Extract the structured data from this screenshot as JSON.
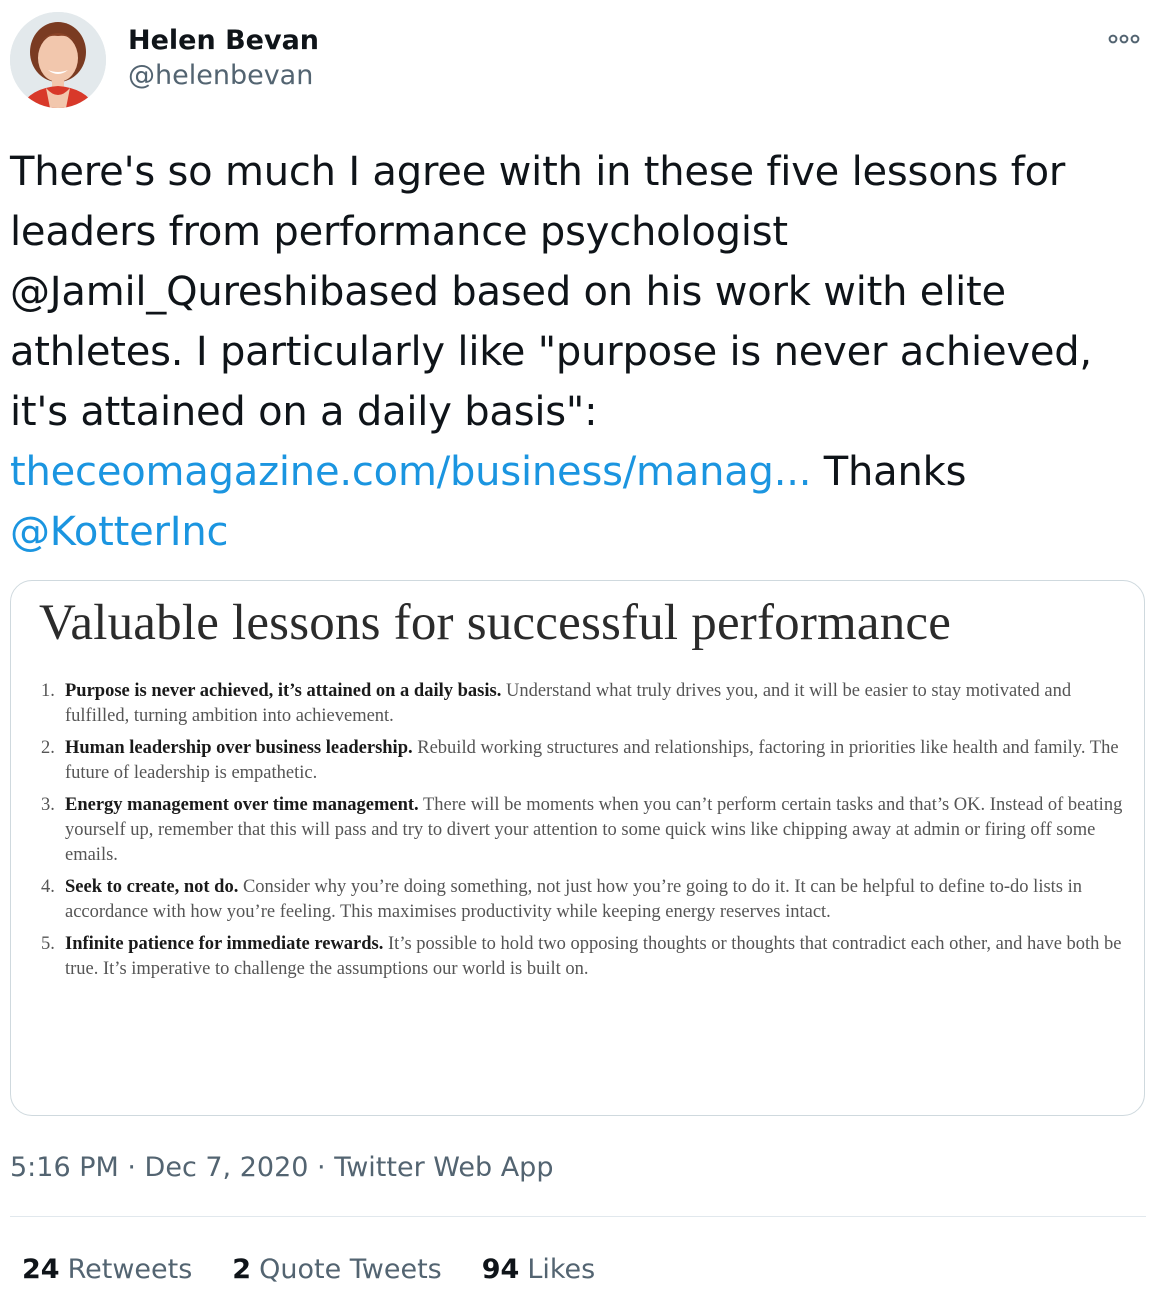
{
  "author": {
    "display_name": "Helen Bevan",
    "handle": "@helenbevan",
    "avatar_icon": "profile-photo"
  },
  "menu": {
    "more_icon": "more-options-icon"
  },
  "tweet": {
    "text_part1": "There's so much I agree with in these five lessons for leaders from performance psychologist @Jamil_Qureshibased based on his work with elite athletes. I particularly like \"purpose is never achieved, it's attained on a daily basis\": ",
    "link_text": "theceomagazine.com/business/manag...",
    "text_part2": " Thanks ",
    "mention": "@KotterInc"
  },
  "media": {
    "title": "Valuable lessons for successful performance",
    "lessons": [
      {
        "number": "1.",
        "heading": "Purpose is never achieved, it’s attained on a daily basis.",
        "body": " Understand what truly drives you, and it will be easier to stay motivated and fulfilled, turning ambition into achievement."
      },
      {
        "number": "2.",
        "heading": "Human leadership over business leadership.",
        "body": " Rebuild working structures and relationships, factoring in priorities like health and family. The future of leadership is empathetic."
      },
      {
        "number": "3.",
        "heading": "Energy management over time management.",
        "body": " There will be moments when you can’t perform certain tasks and that’s OK. Instead of beating yourself up, remember that this will pass and try to divert your attention to some quick wins like chipping away at admin or firing off some emails."
      },
      {
        "number": "4.",
        "heading": "Seek to create, not do.",
        "body": " Consider why you’re doing something, not just how you’re going to do it. It can be helpful to define to-do lists in accordance with how you’re feeling. This maximises productivity while keeping energy reserves intact."
      },
      {
        "number": "5.",
        "heading": "Infinite patience for immediate rewards.",
        "body": " It’s possible to hold two opposing thoughts or thoughts that contradict each other, and have both be true. It’s imperative to challenge the assumptions our world is built on."
      }
    ]
  },
  "meta": {
    "time": "5:16 PM",
    "separator": " · ",
    "date": "Dec 7, 2020",
    "source": "Twitter Web App"
  },
  "stats": {
    "retweets_count": "24",
    "retweets_label": "Retweets",
    "quotes_count": "2",
    "quotes_label": "Quote Tweets",
    "likes_count": "94",
    "likes_label": "Likes"
  },
  "colors": {
    "link": "#1b95e0",
    "text_primary": "#0f1419",
    "text_secondary": "#536471",
    "border": "#cfd9de"
  }
}
